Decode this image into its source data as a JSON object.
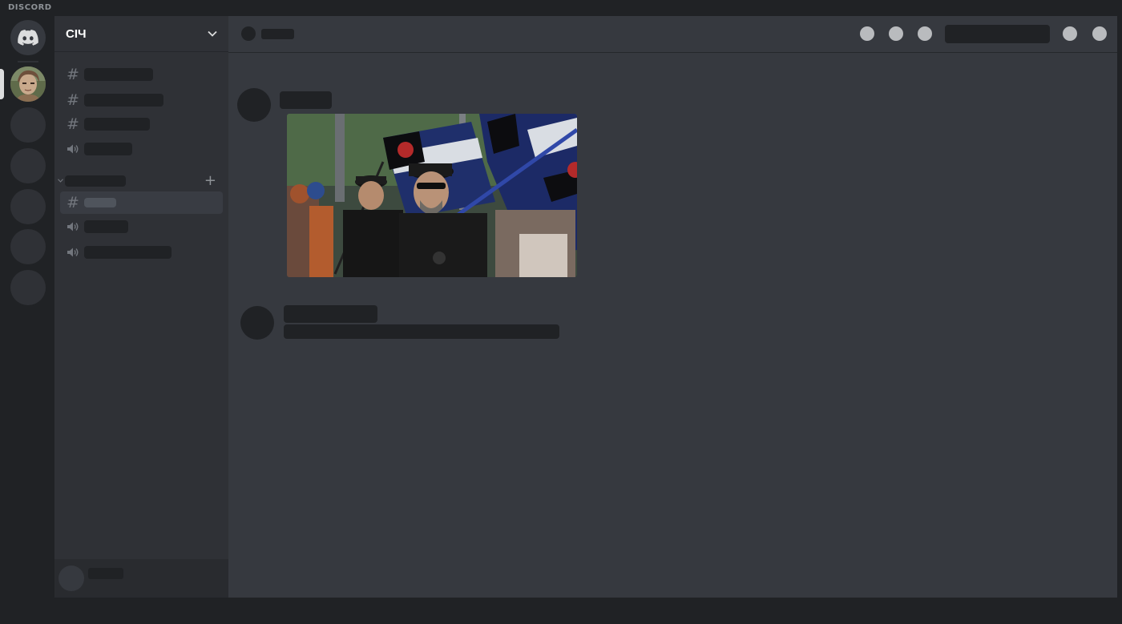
{
  "app": {
    "wordmark": "DISCORD"
  },
  "guild_rail": {
    "home_icon": "discord-logo-icon",
    "guilds": [
      {
        "name": "server-avatar",
        "selected": true
      },
      {
        "name": "server-placeholder"
      },
      {
        "name": "server-placeholder"
      },
      {
        "name": "server-placeholder"
      },
      {
        "name": "server-placeholder"
      },
      {
        "name": "server-placeholder"
      }
    ]
  },
  "sidebar": {
    "server_name": "СІЧ",
    "dropdown_icon": "chevron-down-icon",
    "channels_top": [
      {
        "type": "text",
        "icon": "hashtag-icon"
      },
      {
        "type": "text",
        "icon": "hashtag-icon"
      },
      {
        "type": "text",
        "icon": "hashtag-icon"
      },
      {
        "type": "voice",
        "icon": "speaker-icon"
      }
    ],
    "category": {
      "chevron_icon": "chevron-down-icon",
      "add_icon": "plus-icon",
      "add_glyph": "+"
    },
    "channels_category": [
      {
        "type": "text",
        "icon": "hashtag-icon",
        "selected": true
      },
      {
        "type": "voice",
        "icon": "speaker-icon"
      },
      {
        "type": "voice",
        "icon": "speaker-icon"
      }
    ],
    "hash_glyph": "#"
  },
  "header": {
    "icons": [
      "circle-icon",
      "circle-icon",
      "circle-icon",
      "circle-icon",
      "circle-icon"
    ]
  },
  "colors": {
    "rail": "#202225",
    "sidebar": "#2f3136",
    "main": "#36393f",
    "placeholder": "#202225",
    "selected_channel": "#393c43"
  }
}
